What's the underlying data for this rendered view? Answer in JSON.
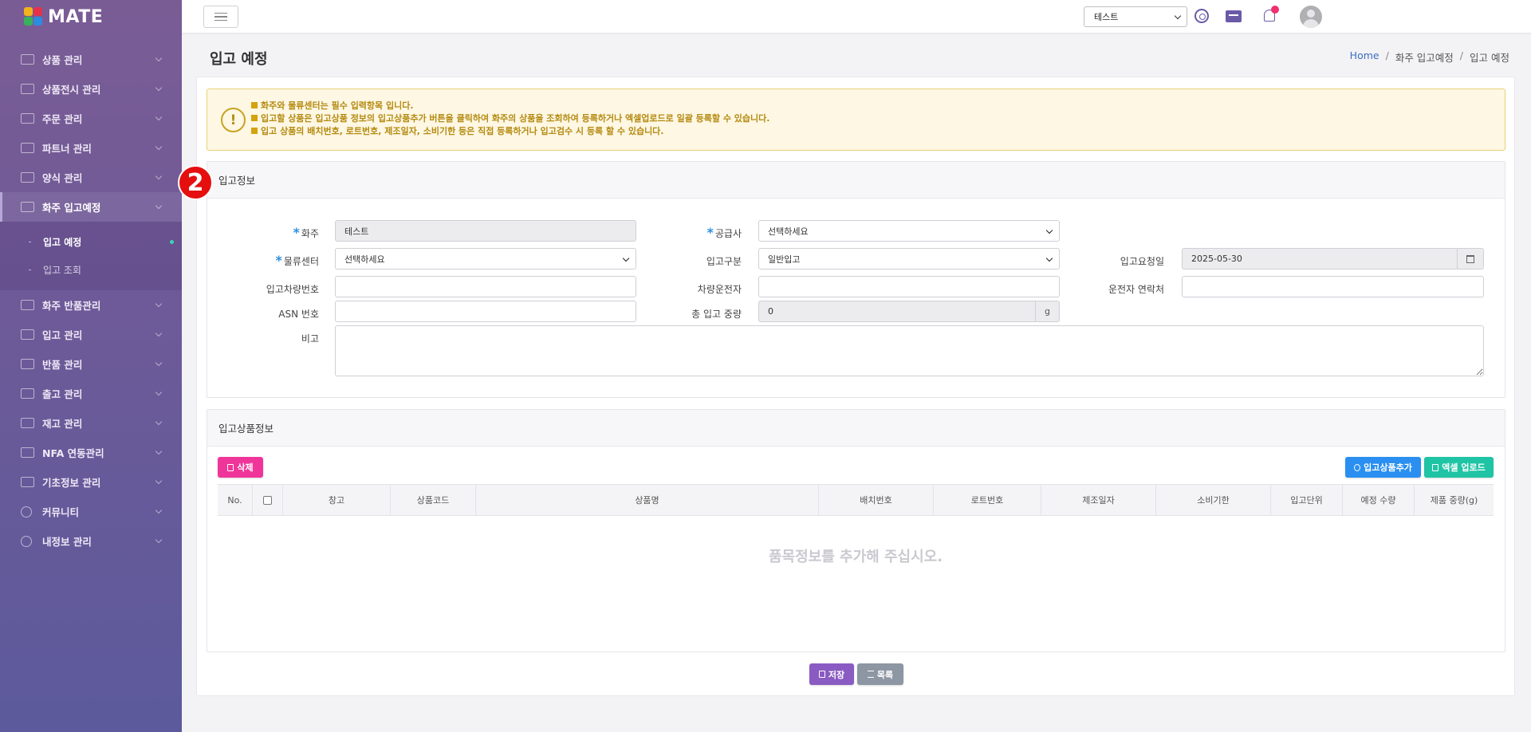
{
  "app": {
    "logo_text": "MATE"
  },
  "sidebar": {
    "items": [
      {
        "label": "상품 관리",
        "icon": "box-icon"
      },
      {
        "label": "상품전시 관리",
        "icon": "display-icon"
      },
      {
        "label": "주문 관리",
        "icon": "cart-icon"
      },
      {
        "label": "파트너 관리",
        "icon": "handshake-icon"
      },
      {
        "label": "양식 관리",
        "icon": "document-icon"
      },
      {
        "label": "화주 입고예정",
        "icon": "truck-icon",
        "active": true
      },
      {
        "label": "화주 반품관리",
        "icon": "return-icon"
      },
      {
        "label": "입고 관리",
        "icon": "receive-icon"
      },
      {
        "label": "반품 관리",
        "icon": "exit-icon"
      },
      {
        "label": "출고 관리",
        "icon": "shipping-icon"
      },
      {
        "label": "재고 관리",
        "icon": "inventory-icon"
      },
      {
        "label": "NFA 연동관리",
        "icon": "link-icon"
      },
      {
        "label": "기초정보 관리",
        "icon": "wrench-icon"
      },
      {
        "label": "커뮤니티",
        "icon": "chat-icon"
      },
      {
        "label": "내정보 관리",
        "icon": "info-icon"
      }
    ],
    "submenu": [
      {
        "label": "입고 예정",
        "active": true
      },
      {
        "label": "입고 조회",
        "active": false
      }
    ]
  },
  "topbar": {
    "shipper_select": "테스트"
  },
  "header": {
    "title": "입고 예정",
    "breadcrumb": [
      "Home",
      "화주 입고예정",
      "입고 예정"
    ]
  },
  "notice": {
    "icon_text": "!",
    "lines": [
      "화주와 물류센터는 필수 입력항목 입니다.",
      "입고할 상품은 입고상품 정보의 입고상품추가 버튼을 클릭하여 화주의 상품을 조회하여 등록하거나 엑셀업로드로 일괄 등록할 수 있습니다.",
      "입고 상품의 배치번호, 로트번호, 제조일자, 소비기한 등은 직접 등록하거나 입고검수 시 등록 할 수 있습니다."
    ]
  },
  "step_badge": "2",
  "inbound_info": {
    "title": "입고정보",
    "labels": {
      "shipper": "화주",
      "supplier": "공급사",
      "center": "물류센터",
      "inbound_type": "입고구분",
      "request_date": "입고요청일",
      "vehicle_no": "입고차량번호",
      "driver": "차량운전자",
      "driver_contact": "운전자 연락처",
      "asn": "ASN 번호",
      "total_weight": "총 입고 중량",
      "remarks": "비고"
    },
    "values": {
      "shipper": "테스트",
      "supplier": "선택하세요",
      "center": "선택하세요",
      "inbound_type": "일반입고",
      "request_date": "2025-05-30",
      "vehicle_no": "",
      "driver": "",
      "driver_contact": "",
      "asn": "",
      "total_weight": "0",
      "weight_unit": "g",
      "remarks": ""
    },
    "required_mark": "*"
  },
  "products": {
    "title": "입고상품정보",
    "buttons": {
      "delete": "삭제",
      "add": "입고상품추가",
      "excel": "엑셀 업로드"
    },
    "columns": [
      "No.",
      "",
      "창고",
      "상품코드",
      "상품명",
      "배치번호",
      "로트번호",
      "제조일자",
      "소비기한",
      "입고단위",
      "예정 수량",
      "제품 중량(g)"
    ],
    "empty_message": "품목정보를 추가해 주십시오."
  },
  "footer_buttons": {
    "save": "저장",
    "list": "목록"
  }
}
